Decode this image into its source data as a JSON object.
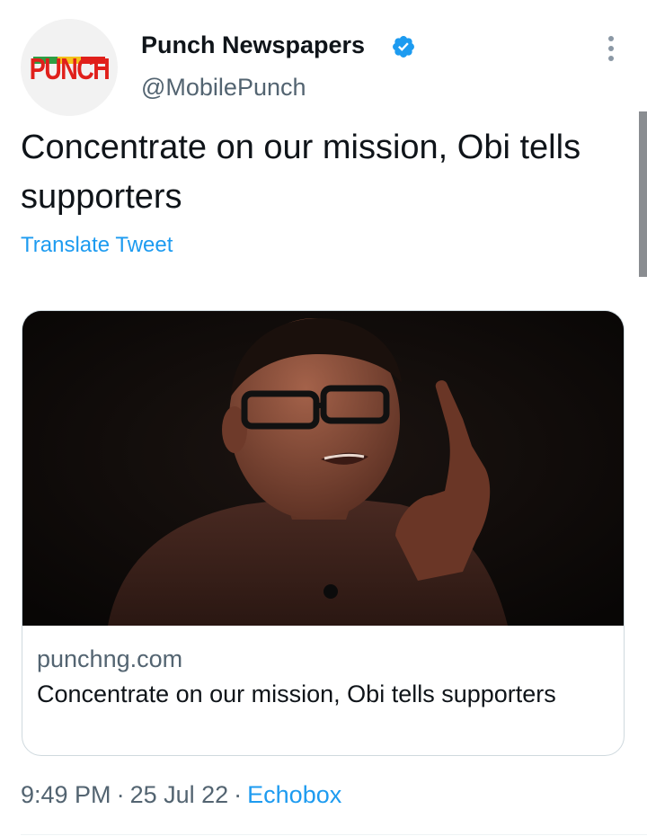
{
  "account": {
    "display_name": "Punch Newspapers",
    "handle": "@MobilePunch",
    "avatar_logo_text": "PUNCH",
    "verified": true
  },
  "tweet": {
    "text": "Concentrate on our mission, Obi tells supporters",
    "translate_label": "Translate Tweet"
  },
  "link_card": {
    "domain": "punchng.com",
    "title": "Concentrate on our mission, Obi tells supporters"
  },
  "metadata": {
    "time": "9:49 PM",
    "date": "25 Jul 22",
    "separator": "·",
    "source": "Echobox"
  },
  "icons": {
    "more": "more-vertical-icon",
    "verified": "verified-badge-icon"
  },
  "colors": {
    "accent": "#1d9bf0",
    "text": "#0f1419",
    "muted": "#536471",
    "brand_red": "#e0201b"
  }
}
